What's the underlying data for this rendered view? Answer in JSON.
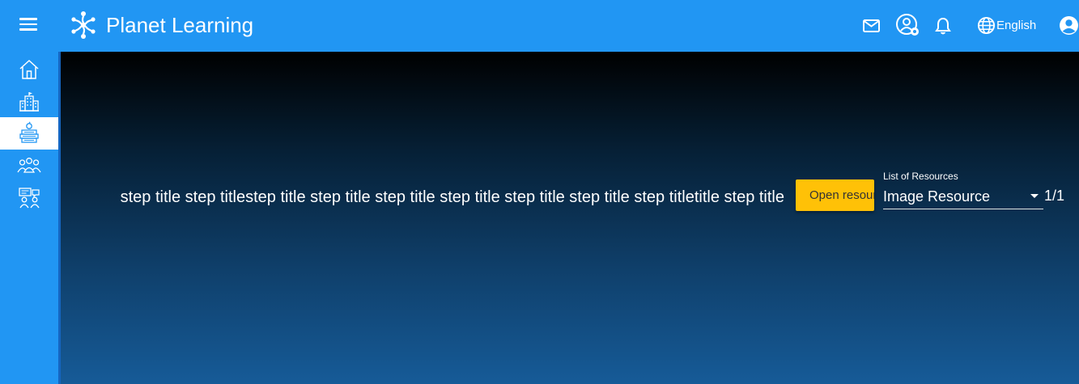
{
  "header": {
    "title": "Planet Learning",
    "language": "English",
    "icons": [
      "menu-icon",
      "planet-logo-icon",
      "mail-icon",
      "user-settings-icon",
      "bell-icon",
      "globe-icon",
      "account-icon"
    ]
  },
  "sidebar": {
    "items": [
      {
        "icon": "home-icon",
        "active": false
      },
      {
        "icon": "library-icon",
        "active": false
      },
      {
        "icon": "courses-icon",
        "active": true
      },
      {
        "icon": "teams-icon",
        "active": false
      },
      {
        "icon": "meetups-icon",
        "active": false
      }
    ]
  },
  "main": {
    "step_text": "step title step titlestep title step title step title step title step title step title step titletitle step title",
    "open_button": "Open resource",
    "resources_label": "List of Resources",
    "resource_selected": "Image Resource",
    "resource_count": "1/1"
  },
  "colors": {
    "primary": "#2196f3",
    "accent": "#ffc107"
  }
}
